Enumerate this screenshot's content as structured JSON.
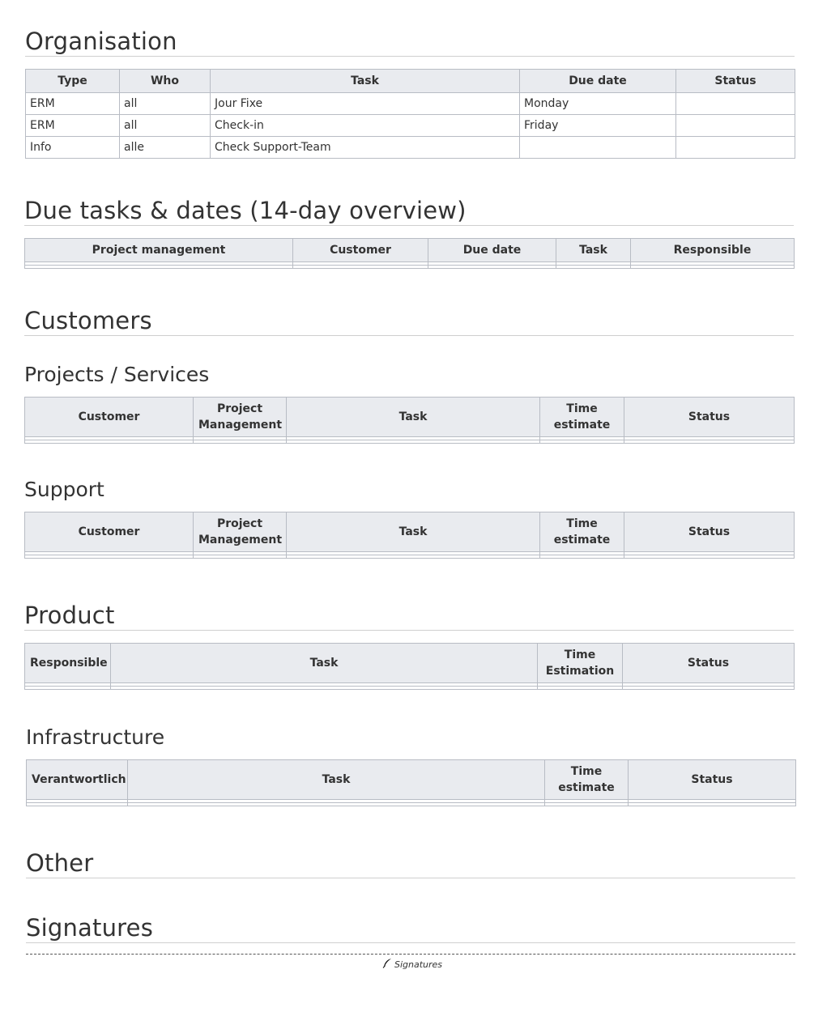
{
  "organisation": {
    "heading": "Organisation",
    "columns": [
      "Type",
      "Who",
      "Task",
      "Due date",
      "Status"
    ],
    "rows": [
      [
        "ERM",
        "all",
        "Jour Fixe",
        "Monday",
        ""
      ],
      [
        "ERM",
        "all",
        "Check-in",
        "Friday",
        ""
      ],
      [
        "Info",
        "alle",
        "Check Support-Team",
        "",
        ""
      ]
    ]
  },
  "due_tasks": {
    "heading": "Due tasks & dates (14-day overview)",
    "columns": [
      "Project management",
      "Customer",
      "Due date",
      "Task",
      "Responsible"
    ]
  },
  "customers": {
    "heading": "Customers",
    "projects": {
      "heading": "Projects / Services",
      "columns": [
        "Customer",
        "Project Management",
        "Task",
        "Time estimate",
        "Status"
      ]
    },
    "support": {
      "heading": "Support",
      "columns": [
        "Customer",
        "Project Management",
        "Task",
        "Time estimate",
        "Status"
      ]
    }
  },
  "product": {
    "heading": "Product",
    "columns": [
      "Responsible",
      "Task",
      "Time Estimation",
      "Status"
    ]
  },
  "infrastructure": {
    "heading": "Infrastructure",
    "columns": [
      "Verantwortlich",
      "Task",
      "Time estimate",
      "Status"
    ]
  },
  "other": {
    "heading": "Other"
  },
  "signatures": {
    "heading": "Signatures",
    "label": "Signatures",
    "icon": "feather-pen-icon"
  }
}
